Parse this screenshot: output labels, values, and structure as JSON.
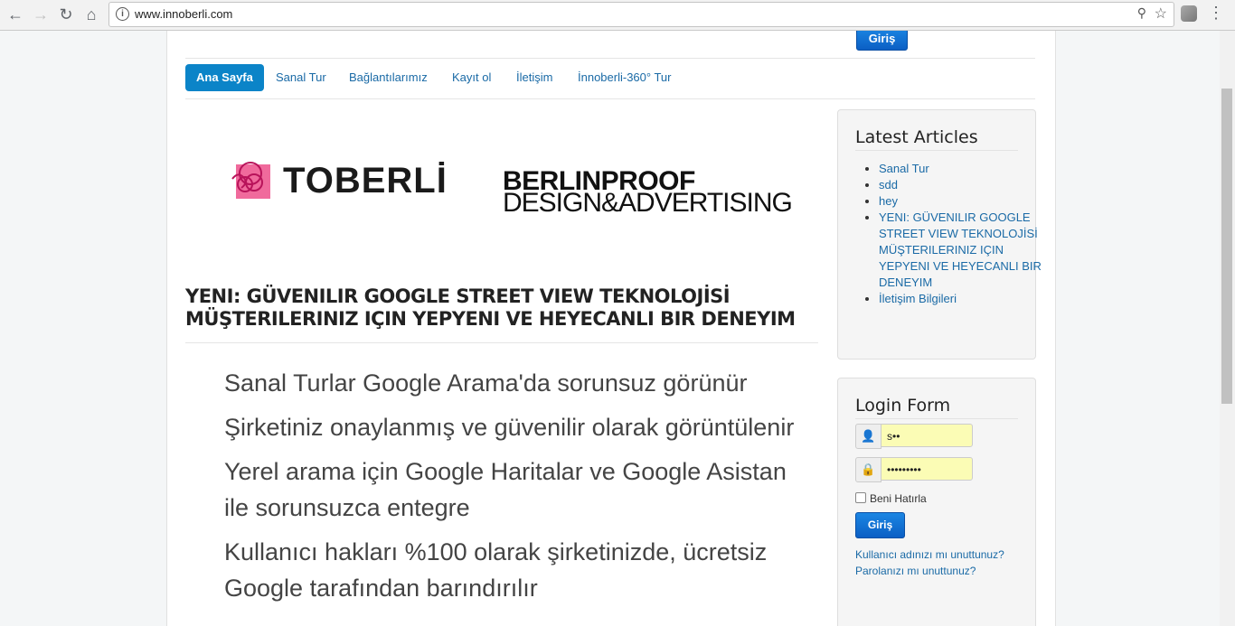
{
  "browser": {
    "url": "www.innoberli.com",
    "back_icon": "arrow-left-icon",
    "forward_icon": "arrow-right-icon",
    "reload_icon": "reload-icon",
    "home_icon": "home-icon",
    "star_icon": "star-icon"
  },
  "header": {
    "top_login_label": "Giriş"
  },
  "menu": {
    "items": [
      {
        "label": "Ana Sayfa",
        "active": true
      },
      {
        "label": "Sanal Tur"
      },
      {
        "label": "Bağlantılarımız"
      },
      {
        "label": "Kayıt ol"
      },
      {
        "label": "İletişim"
      },
      {
        "label": "İnnoberli-360° Tur"
      }
    ]
  },
  "logos": {
    "toberli": "TOBERLİ",
    "berlin_line1": "BERLINPROOF",
    "berlin_line2": "DESIGN&ADVERTISING"
  },
  "article": {
    "title": "YENI: GÜVENILIR GOOGLE STREET VIEW TEKNOLOJİSİ MÜŞTERILERINIZ IÇIN YEPYENI VE HEYECANLI BIR DENEYIM",
    "paragraphs": [
      "Sanal Turlar Google Arama'da sorunsuz görünür",
      "Şirketiniz onaylanmış ve güvenilir olarak görüntülenir",
      "Yerel arama için Google Haritalar ve Google Asistan ile sorunsuzca entegre",
      "Kullanıcı hakları %100 olarak şirketinizde, ücretsiz Google tarafından barındırılır"
    ]
  },
  "sidebar": {
    "latest": {
      "title": "Latest Articles",
      "items": [
        "Sanal Tur",
        "sdd",
        "hey",
        "YENI: GÜVENILIR GOOGLE STREET VIEW TEKNOLOJİSİ MÜŞTERILERINIZ IÇIN YEPYENI VE HEYECANLI BIR DENEYIM",
        "İletişim Bilgileri"
      ]
    },
    "login": {
      "title": "Login Form",
      "username_value": "s••",
      "password_value": "•••••••••",
      "remember_label": "Beni Hatırla",
      "button_label": "Giriş",
      "forgot_username": "Kullanıcı adınızı mı unuttunuz?",
      "forgot_password": "Parolanızı mı unuttunuz?"
    }
  },
  "colors": {
    "accent": "#0b84c8",
    "link": "#1a6aa6",
    "button": "#0b5fc4"
  }
}
